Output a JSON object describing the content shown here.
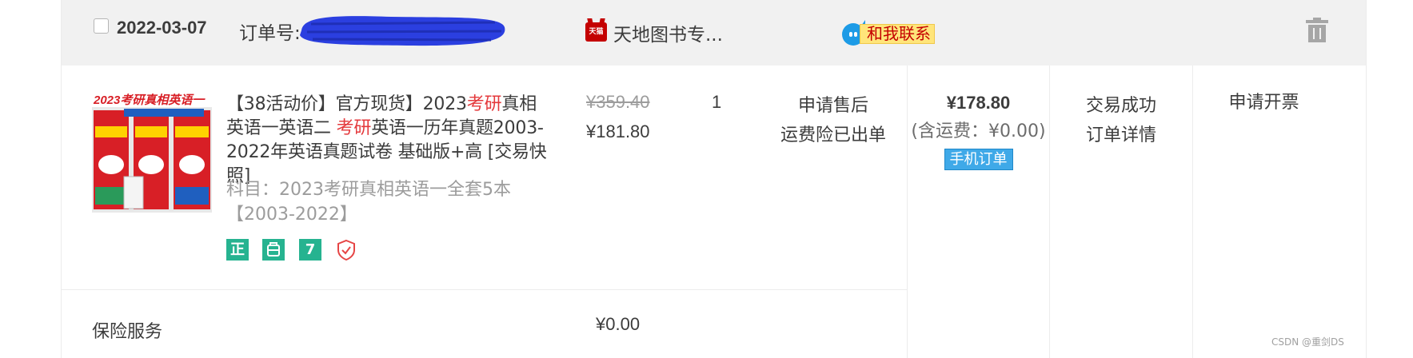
{
  "order": {
    "date": "2022-03-07",
    "order_no_label": "订单号:",
    "shop_name": "天地图书专...",
    "shop_logo_text": "天猫",
    "contact_label": "和我联系"
  },
  "product": {
    "title_parts": [
      "【38活动价】官方现货】2023",
      "考研",
      "真相英语一英语二 ",
      "考研",
      "英语一历年真题2003-2022年英语真题试卷 基础版+高 [交易快照]"
    ],
    "sku_text": "科目：2023考研真相英语一全套5本【2003-2022】",
    "badges": [
      "正",
      "",
      "7"
    ],
    "original_price": "¥359.40",
    "current_price": "¥181.80",
    "quantity": "1",
    "after_sale": [
      "申请售后",
      "运费险已出单"
    ]
  },
  "total": {
    "amount": "¥178.80",
    "shipping": "(含运费：¥0.00)",
    "mobile_tag": "手机订单"
  },
  "status": {
    "status_text": "交易成功",
    "details_link": "订单详情"
  },
  "invoice": "申请开票",
  "insurance": {
    "label": "保险服务",
    "price": "¥0.00"
  },
  "watermark": "CSDN @重剑DS",
  "colors": {
    "header_bg": "#f1f1f1",
    "highlight_red": "#e4393c",
    "badge_green": "#26b390",
    "contact_yellow": "#ffe57a",
    "mobile_blue": "#3fa9e8",
    "redaction_blue": "#2b3fe0"
  }
}
